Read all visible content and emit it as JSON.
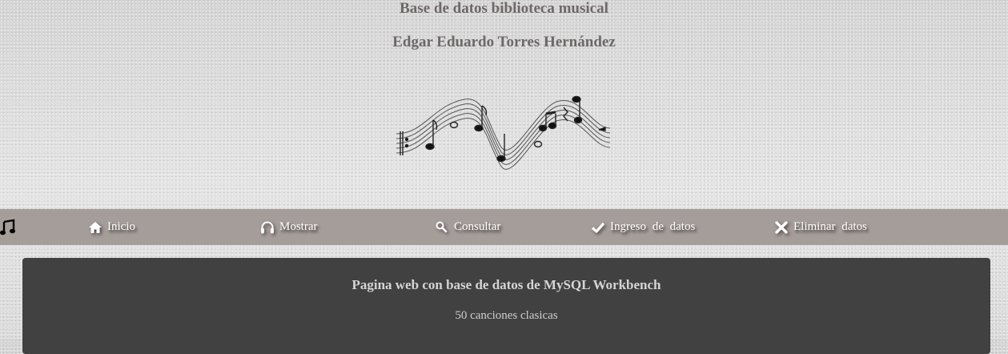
{
  "header": {
    "title": "Base de datos biblioteca musical",
    "author": "Edgar Eduardo Torres Hernández",
    "banner_icon": "music-staff-banner"
  },
  "nav": {
    "logo_icon": "music-note-icon",
    "items": [
      {
        "label": "Inicio",
        "icon": "home-icon"
      },
      {
        "label": "Mostrar",
        "icon": "headphones-icon"
      },
      {
        "label": "Consultar",
        "icon": "search-icon"
      },
      {
        "label": "Ingreso de datos",
        "icon": "check-icon"
      },
      {
        "label": "Eliminar datos",
        "icon": "close-icon"
      }
    ]
  },
  "main": {
    "title": "Pagina web con base de datos de MySQL Workbench",
    "subtitle": "50 canciones clasicas"
  },
  "colors": {
    "nav_background": "#a59d9a",
    "panel_background": "#414141",
    "header_text": "#6e6868"
  }
}
